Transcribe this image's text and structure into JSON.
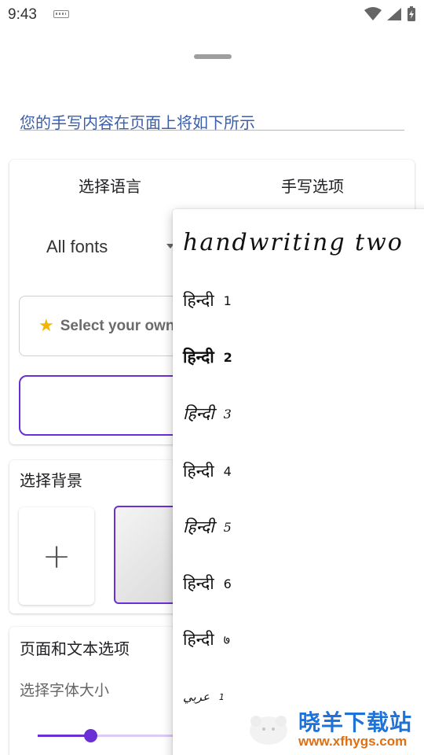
{
  "status_bar": {
    "time": "9:43"
  },
  "sheet": {
    "preview_text": "您的手写内容在页面上将如下所示"
  },
  "language_card": {
    "tabs": [
      "选择语言",
      "手写选项"
    ],
    "font_select_value": "All fonts",
    "own_font_label": "Select your own font"
  },
  "background_card": {
    "title": "选择背景",
    "add_label": "+"
  },
  "page_card": {
    "title": "页面和文本选项",
    "font_size_label": "选择字体大小",
    "font_size_level": 0.28
  },
  "dropdown": {
    "items": [
      {
        "text": "handwriting two",
        "num": ""
      },
      {
        "text": "हिन्दी",
        "num": "1"
      },
      {
        "text": "हिन्दी",
        "num": "2"
      },
      {
        "text": "हिन्दी",
        "num": "3"
      },
      {
        "text": "हिन्दी",
        "num": "4"
      },
      {
        "text": "हिन्दी",
        "num": "5"
      },
      {
        "text": "हिन्दी",
        "num": "6"
      },
      {
        "text": "हिन्दी",
        "num": "७"
      },
      {
        "text": "عربي",
        "num": "1"
      }
    ]
  },
  "watermark": {
    "title": "晓羊下载站",
    "url": "www.xfhygs.com"
  },
  "colors": {
    "accent": "#6b2fd6",
    "link_text": "#3c5ea8",
    "watermark_blue": "#1e72d8",
    "watermark_orange": "#e06f10"
  }
}
